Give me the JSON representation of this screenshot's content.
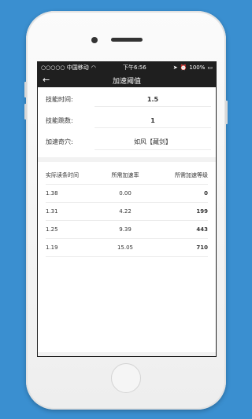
{
  "status_bar": {
    "carrier": "○○○○○ 中国移动",
    "time": "下午6:56",
    "battery": "100%",
    "icons": [
      "wifi-icon",
      "location-icon",
      "alarm-icon",
      "battery-icon"
    ]
  },
  "nav": {
    "title": "加速阈值",
    "back_icon": "←"
  },
  "form": {
    "skill_time": {
      "label": "技能时间:",
      "value": "1.5"
    },
    "skill_hops": {
      "label": "技能跳数:",
      "value": "1"
    },
    "acupoint": {
      "label": "加速奇穴:",
      "value": "如风【藏剑】"
    }
  },
  "table": {
    "headers": [
      "实际读条时间",
      "所需加速率",
      "所需加速等级"
    ],
    "rows": [
      [
        "1.38",
        "0.00",
        "0"
      ],
      [
        "1.31",
        "4.22",
        "199"
      ],
      [
        "1.25",
        "9.39",
        "443"
      ],
      [
        "1.19",
        "15.05",
        "710"
      ]
    ]
  }
}
